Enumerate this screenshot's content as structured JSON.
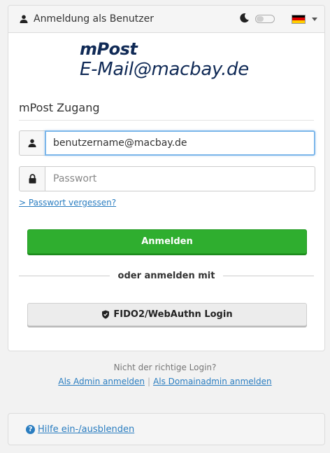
{
  "header": {
    "title": "Anmeldung als Benutzer",
    "user_icon": "user-icon",
    "theme_icon": "moon-icon",
    "language_flag": "germany-flag-icon",
    "flag_colors": [
      "#000000",
      "#dd0000",
      "#ffce00"
    ]
  },
  "logo": {
    "line1": "mPost",
    "line2": "E-Mail@macbay.de"
  },
  "login": {
    "section_title": "mPost Zugang",
    "username_value": "benutzername@macbay.de",
    "password_placeholder": "Passwort",
    "forgot_link": "> Passwort vergessen?",
    "submit_label": "Anmelden",
    "divider_text": "oder anmelden mit",
    "fido_label": "FIDO2/WebAuthn Login"
  },
  "alt_login": {
    "prompt": "Nicht der richtige Login?",
    "admin_link": "Als Admin anmelden",
    "separator": "|",
    "domain_admin_link": "Als Domainadmin anmelden"
  },
  "help": {
    "toggle_label": "Hilfe ein-/ausblenden",
    "icon_glyph": "?"
  },
  "colors": {
    "primary_button": "#2fae2f",
    "link": "#2a7dc0",
    "logo": "#102a56"
  }
}
